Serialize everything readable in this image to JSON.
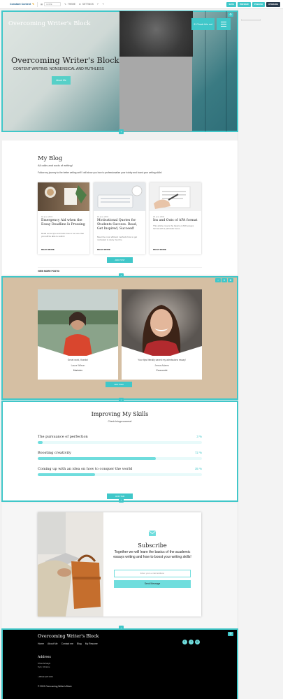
{
  "toolbar": {
    "logo": "Constant Content",
    "page_select": "HOME",
    "theme_label": "THEME",
    "settings_label": "SETTINGS",
    "save": "SAVE",
    "preview": "PREVIEW",
    "publish": "PUBLISH",
    "upgrade": "UPGRADE",
    "colors": {
      "teal": "#40c7c9",
      "dark": "#2a3b4c"
    }
  },
  "hero": {
    "brand": "Overcoming Writer's Block",
    "cta": "Check this out",
    "title": "Overcoming Writer's Block",
    "subtitle": "CONTENT WRITING: NONSENSICAL AND RUTHLESS",
    "button": "About Me"
  },
  "blog": {
    "title": "My Blog",
    "subtitle": "All odds and sods of writing!",
    "description": "Follow my journey to the better writing self! I will show you how to professionalize your hobby and boost your writing skills!",
    "posts": [
      {
        "date": "18 june 2019",
        "title": "Emergency Aid when the Essay Deadline Is Pressing",
        "excerpt": "Read some tips and tricks how to be sure that you will be able to submit",
        "more": "READ MORE"
      },
      {
        "date": "18 june 2019",
        "title": "Motivational Quotes for Students Success. Read, Get Inspired, Succeed!",
        "excerpt": "Meet the most efficient methods how to get motivated to study. Get the",
        "more": "READ MORE"
      },
      {
        "date": "18 june 2019",
        "title": "Ins and Outs of APA format",
        "excerpt": "This article covers the basics of APA essays format with a particular focus",
        "more": "READ MORE"
      }
    ],
    "add_button": "ADD POST",
    "view_more": "VIEW MORE POSTS ›"
  },
  "testimonials": {
    "items": [
      {
        "quote": "Great work, thanks!",
        "name": "Laura Wilson",
        "role": "Marketer"
      },
      {
        "quote": "Your tips literally saved my admissions essay!",
        "name": "Jenna Adams",
        "role": "Economist"
      }
    ],
    "add_button": "ADD ITEM"
  },
  "skills": {
    "title": "Improving My Skills",
    "subtitle": "Check brings success!",
    "items": [
      {
        "label": "The pursuance of perfection",
        "pct_label": "3 %",
        "value": 3
      },
      {
        "label": "Boosting creativity",
        "pct_label": "72 %",
        "value": 72
      },
      {
        "label": "Coming up with an idea on how to conquer the world",
        "pct_label": "35 %",
        "value": 35
      }
    ],
    "add_button": "ADD ITEM"
  },
  "subscribe": {
    "title": "Subscribe",
    "text": "Together we will learn the basics of the academic essays writing and how to boost your writing skills!",
    "placeholder": "Enter your e-mail address",
    "button": "Send Message"
  },
  "footer": {
    "brand": "Overcoming Writer's Block",
    "nav": [
      "Home",
      "About Me",
      "Contact me",
      "Blog",
      "My Resume"
    ],
    "address_heading": "Address",
    "address_line1": "Khreshchatyk",
    "address_line2": "Kyiv, Ukraine",
    "phone": "+380(11)221044",
    "copyright": "© 2019 Overcoming Writer's Block"
  }
}
